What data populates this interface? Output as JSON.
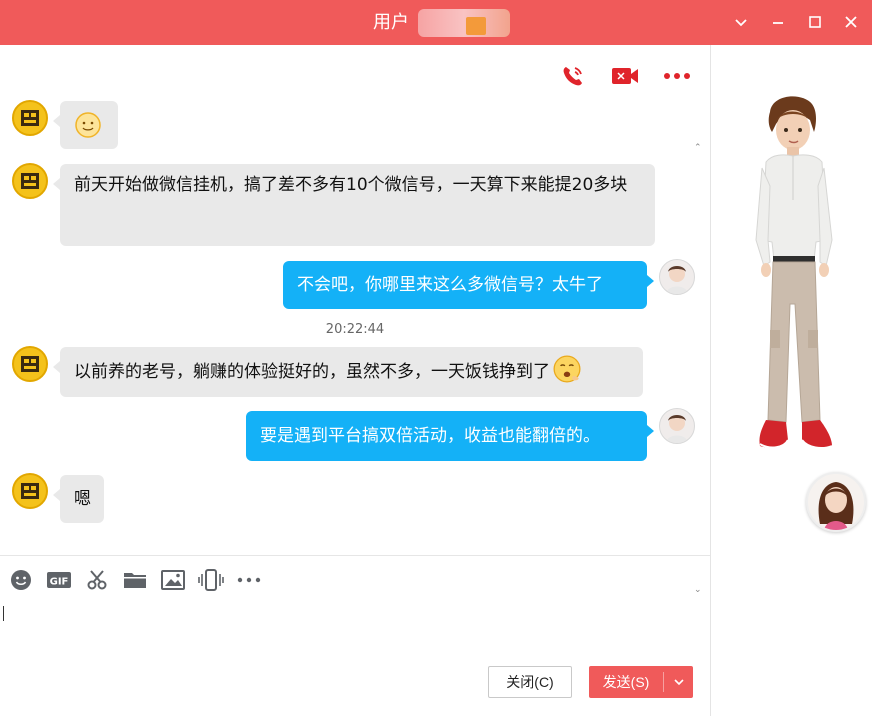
{
  "window": {
    "title": "用户"
  },
  "top_actions": {
    "voice_call_icon": "phone-icon",
    "video_call_icon": "video-camera-icon",
    "more_icon": "more-dots-icon"
  },
  "messages": [
    {
      "from": "user",
      "text": "",
      "emoji": "smile-emoji"
    },
    {
      "from": "user",
      "text": "前天开始做微信挂机，搞了差不多有10个微信号，一天算下来能提20多块"
    },
    {
      "from": "self",
      "text": "不会吧，你哪里来这么多微信号？太牛了"
    },
    {
      "from": "user",
      "text": "以前养的老号，躺赚的体验挺好的，虽然不多，一天饭钱挣到了"
    },
    {
      "from": "self",
      "text": "要是遇到平台搞双倍活动，收益也能翻倍的。"
    },
    {
      "from": "user",
      "text": "嗯"
    }
  ],
  "timestamp": "20:22:44",
  "toolbar": {
    "gif_label": "GIF"
  },
  "buttons": {
    "close_label": "关闭(C)",
    "send_label": "发送(S)"
  },
  "colors": {
    "brand": "#f05a5a",
    "bubble_out": "#14b1f7",
    "bubble_in": "#e9e9e9"
  }
}
